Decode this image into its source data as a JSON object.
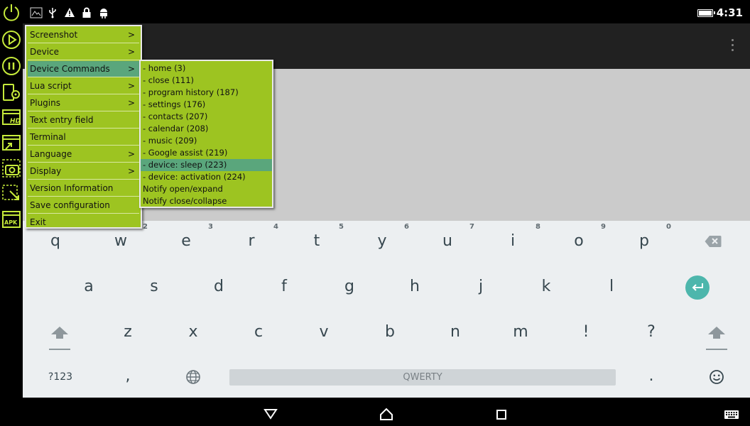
{
  "status": {
    "time": "4:31"
  },
  "main_menu": {
    "items": [
      {
        "label": "Screenshot",
        "submenu": true
      },
      {
        "label": "Device",
        "submenu": true
      },
      {
        "label": "Device Commands",
        "submenu": true,
        "selected": true
      },
      {
        "label": "Lua script",
        "submenu": true
      },
      {
        "label": "Plugins",
        "submenu": true
      },
      {
        "label": "Text entry field",
        "submenu": false
      },
      {
        "label": "Terminal",
        "submenu": false
      },
      {
        "label": "Language",
        "submenu": true
      },
      {
        "label": "Display",
        "submenu": true
      },
      {
        "label": "Version Information",
        "submenu": false
      },
      {
        "label": "Save configuration",
        "submenu": false
      },
      {
        "label": "Exit",
        "submenu": false
      }
    ],
    "arrow": ">"
  },
  "sub_menu": {
    "items": [
      {
        "label": "- home (3)"
      },
      {
        "label": "- close (111)"
      },
      {
        "label": "- program history (187)"
      },
      {
        "label": "- settings (176)"
      },
      {
        "label": "- contacts (207)"
      },
      {
        "label": "- calendar (208)"
      },
      {
        "label": "- music (209)"
      },
      {
        "label": "- Google assist (219)"
      },
      {
        "label": "- device: sleep (223)",
        "selected": true
      },
      {
        "label": "- device: activation (224)"
      },
      {
        "label": "Notify open/expand"
      },
      {
        "label": "Notify close/collapse"
      }
    ]
  },
  "keyboard": {
    "row1": [
      "q",
      "w",
      "e",
      "r",
      "t",
      "y",
      "u",
      "i",
      "o",
      "p"
    ],
    "hints": [
      "2",
      "3",
      "4",
      "5",
      "6",
      "7",
      "8",
      "9",
      "0"
    ],
    "row2": [
      "a",
      "s",
      "d",
      "f",
      "g",
      "h",
      "j",
      "k",
      "l"
    ],
    "row3": [
      "z",
      "x",
      "c",
      "v",
      "b",
      "n",
      "m",
      "!",
      "?"
    ],
    "symbols_label": "?123",
    "comma": ",",
    "period": ".",
    "space_label": "QWERTY"
  },
  "colors": {
    "menu_bg": "#9dc421",
    "menu_selected": "#5aa67c",
    "accent": "#c6ea3b",
    "enter": "#4db6ac"
  }
}
